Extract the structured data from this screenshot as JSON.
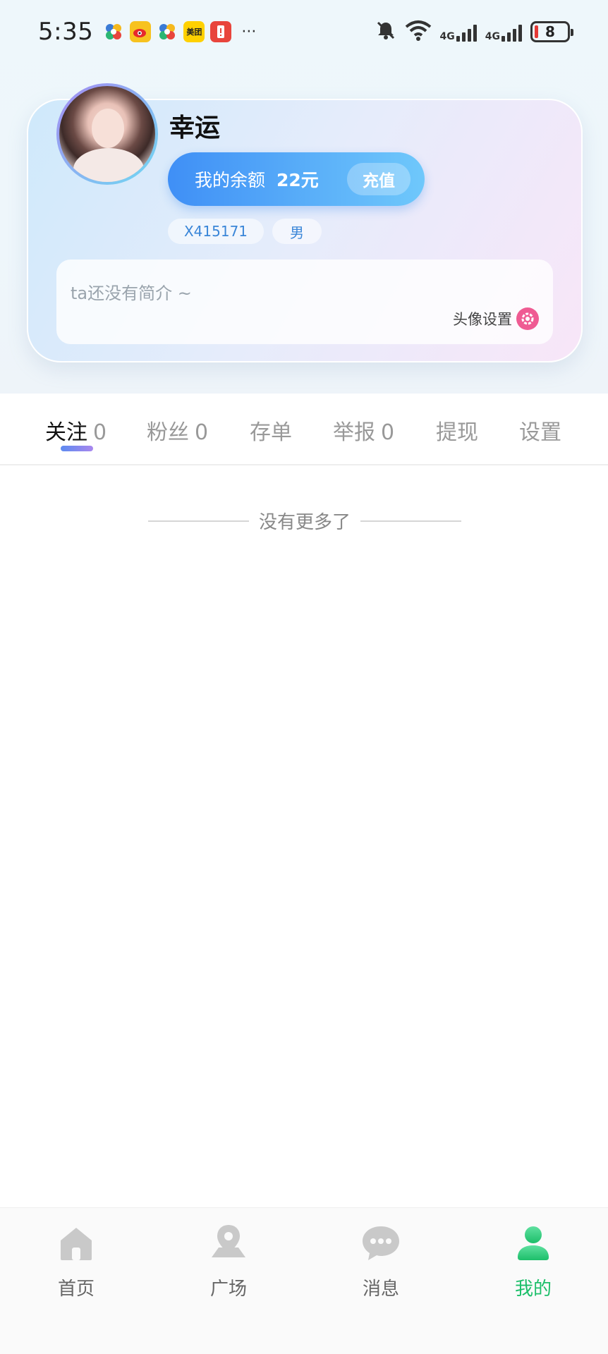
{
  "status_bar": {
    "time": "5:35",
    "more": "···",
    "battery": "8",
    "network": [
      "4G",
      "4G"
    ],
    "apps": [
      "app-icon-pinwheel",
      "weibo-icon",
      "app-icon-pinwheel",
      "meituan-icon",
      "alert-app-icon"
    ],
    "app_meituan": "美团"
  },
  "profile": {
    "username": "幸运",
    "balance_label": "我的余额",
    "balance_value": "22元",
    "recharge": "充值",
    "user_id": "X415171",
    "gender": "男",
    "bio_placeholder": "ta还没有简介 ~",
    "avatar_setting": "头像设置"
  },
  "tabs": [
    {
      "label": "关注",
      "count": "0",
      "active": true
    },
    {
      "label": "粉丝",
      "count": "0"
    },
    {
      "label": "存单",
      "count": ""
    },
    {
      "label": "举报",
      "count": "0"
    },
    {
      "label": "提现",
      "count": ""
    },
    {
      "label": "设置",
      "count": ""
    }
  ],
  "list": {
    "empty_text": "没有更多了"
  },
  "bottom_nav": [
    {
      "label": "首页",
      "icon": "home-icon"
    },
    {
      "label": "广场",
      "icon": "map-pin-icon"
    },
    {
      "label": "消息",
      "icon": "chat-bubble-icon"
    },
    {
      "label": "我的",
      "icon": "user-icon",
      "active": true
    }
  ],
  "colors": {
    "accent_green": "#1dbf6a",
    "balance_gradient_start": "#3f8ff6",
    "balance_gradient_end": "#6fc8fb",
    "tag_text": "#3a86d8",
    "gear": "#ef5b93"
  }
}
